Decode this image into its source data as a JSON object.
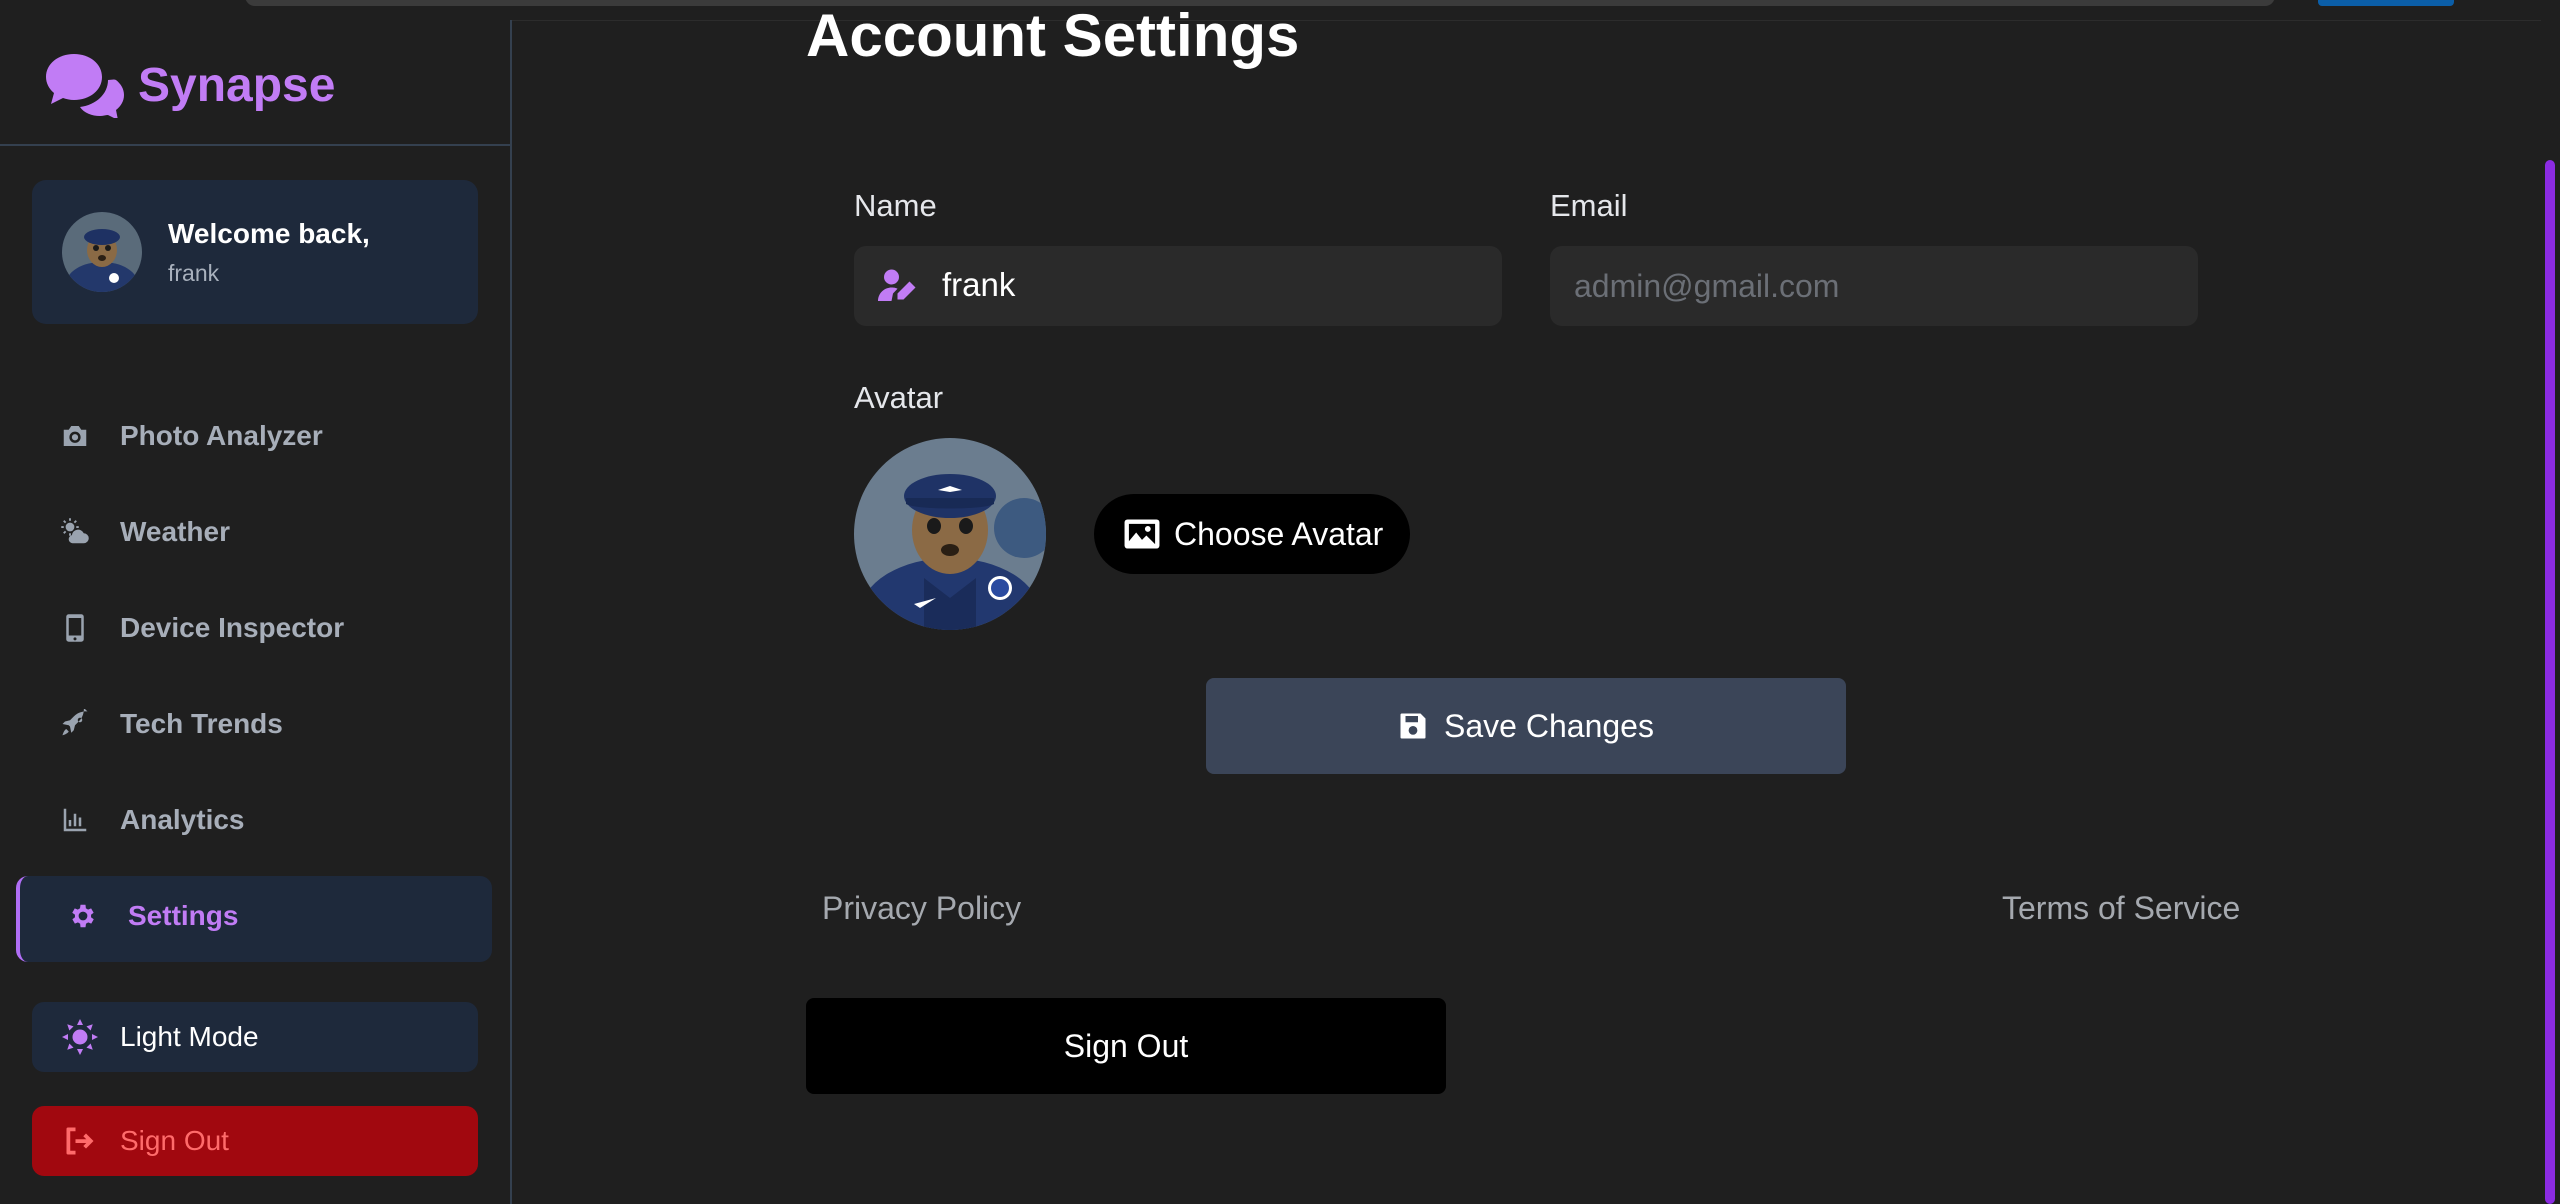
{
  "app": {
    "name": "Synapse",
    "brand_color": "#c17cf5"
  },
  "welcome": {
    "title": "Welcome back,",
    "username": "frank"
  },
  "sidebar": {
    "items": [
      {
        "label": "Photo Analyzer",
        "icon": "camera-icon"
      },
      {
        "label": "Weather",
        "icon": "cloud-sun-icon"
      },
      {
        "label": "Device Inspector",
        "icon": "phone-icon"
      },
      {
        "label": "Tech Trends",
        "icon": "rocket-icon"
      },
      {
        "label": "Analytics",
        "icon": "bar-chart-icon"
      },
      {
        "label": "Settings",
        "icon": "gear-icon",
        "active": true
      }
    ],
    "light_mode_label": "Light Mode",
    "sign_out_label": "Sign Out"
  },
  "main": {
    "title": "Account Settings",
    "name_label": "Name",
    "name_value": "frank",
    "email_label": "Email",
    "email_placeholder": "admin@gmail.com",
    "avatar_label": "Avatar",
    "choose_avatar_label": "Choose Avatar",
    "save_label": "Save Changes",
    "privacy_label": "Privacy Policy",
    "terms_label": "Terms of Service",
    "sign_out_label": "Sign Out"
  },
  "colors": {
    "background": "#1f1f1f",
    "card": "#1e293b",
    "accent": "#c17cf5",
    "danger": "#a1080f",
    "scrollbar": "#8b2be2"
  }
}
